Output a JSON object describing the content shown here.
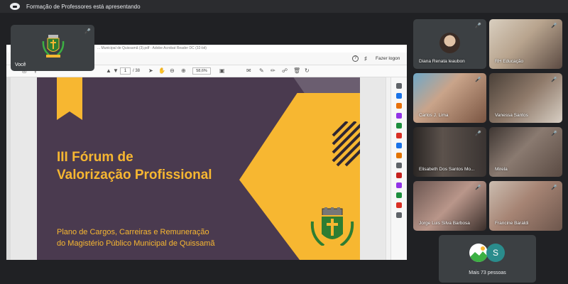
{
  "presenting_banner": "Formação de Professores está apresentando",
  "self_view": {
    "name": "Você"
  },
  "pdf_viewer": {
    "window_title": "... Municipal de Quissamã (3).pdf - Adobe Acrobat Reader DC (32-bit)",
    "login_label": "Fazer logon",
    "page_current": "1",
    "page_total": "/ 38",
    "zoom": "58,6%"
  },
  "slide": {
    "title_line1": "III Fórum de",
    "title_line2": "Valorização Profissional",
    "subtitle_line1": "Plano de Cargos, Carreiras e Remuneração",
    "subtitle_line2": "do Magistério Público Municipal de Quissamã"
  },
  "participants": [
    {
      "name": "Diana Renata leaubon"
    },
    {
      "name": "RH Educação"
    },
    {
      "name": "Carlos J. Lima"
    },
    {
      "name": "Vanessa Santos"
    },
    {
      "name": "Elisabeth Dos Santos Mo..."
    },
    {
      "name": "Mirela"
    },
    {
      "name": "Jorge Luis Silva Barbosa"
    },
    {
      "name": "Francine Baraldi"
    }
  ],
  "more_people": {
    "label": "Mais 73 pessoas",
    "avatar_letter": "S"
  },
  "colors": {
    "slide_bg": "#4a3a4f",
    "slide_accent": "#f7b731",
    "meet_bg": "#202124",
    "tile_bg": "#3c4043"
  }
}
